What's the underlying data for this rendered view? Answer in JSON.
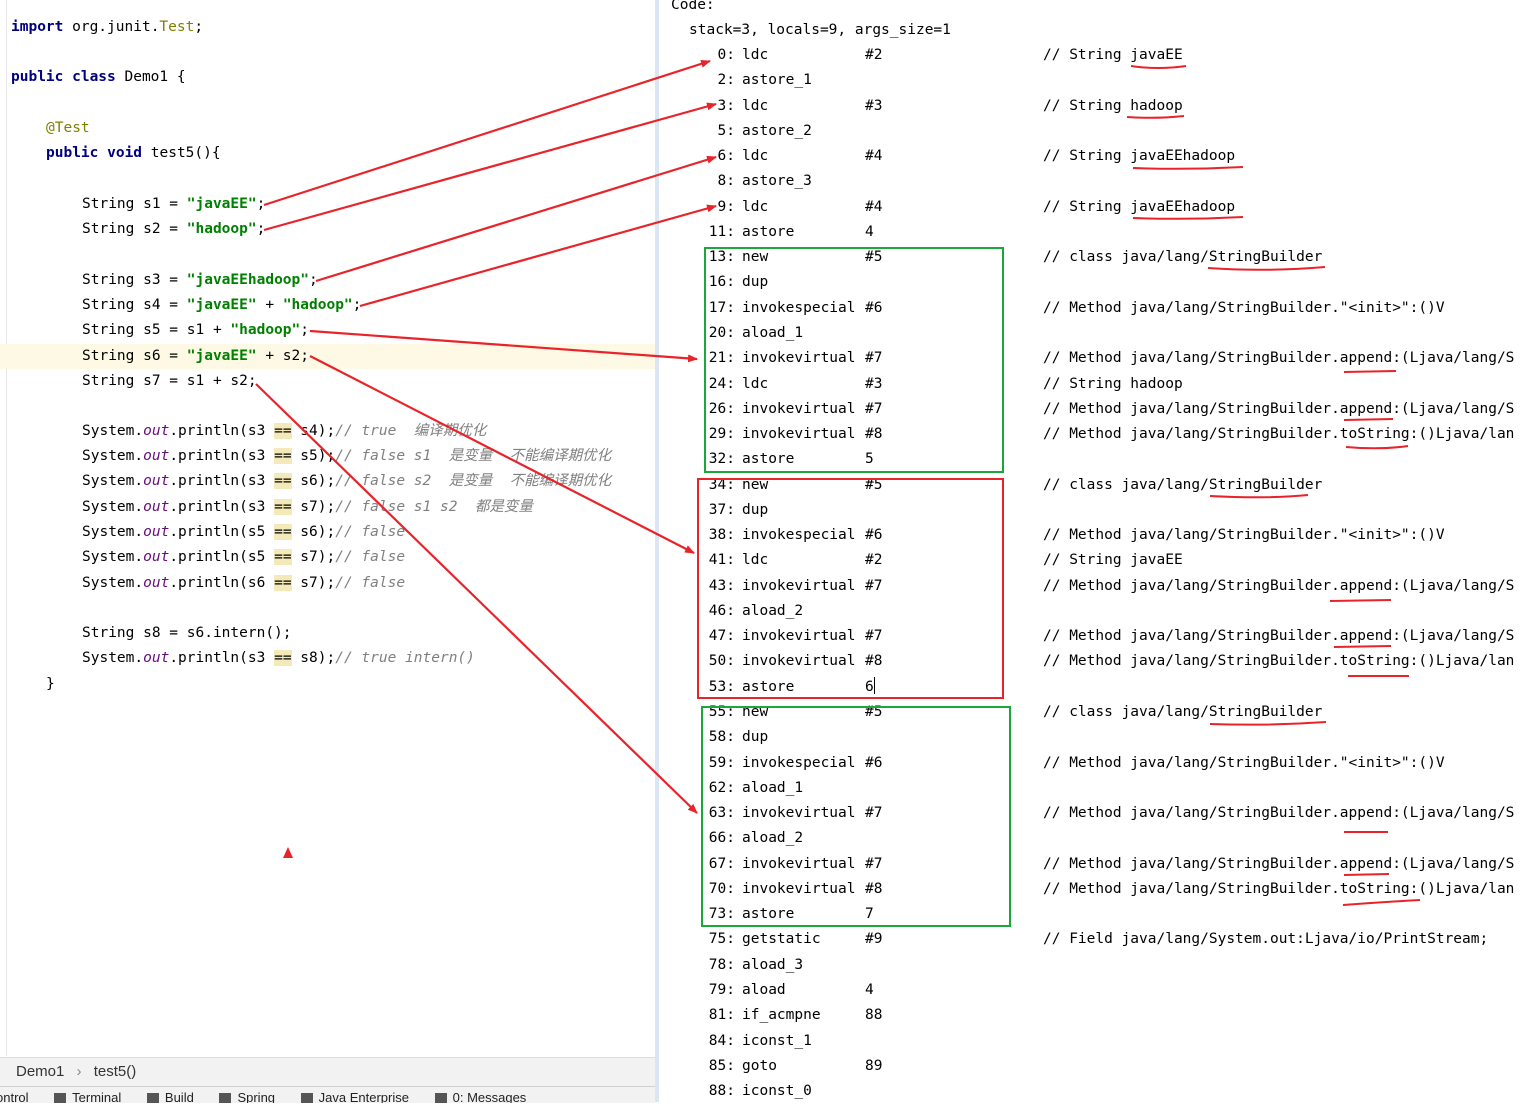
{
  "source": {
    "l1": {
      "kw": "import",
      "rest": " org.junit.",
      "cls": "Test",
      "end": ";"
    },
    "l2": {
      "kw": "public class",
      "rest": " Demo1 {"
    },
    "l3": {
      "ann": "@Test"
    },
    "l4": {
      "kw": "public void",
      "rest": " test5(){"
    },
    "s1": {
      "pre": "String s1 = ",
      "str": "\"javaEE\"",
      "end": ";"
    },
    "s2": {
      "pre": "String s2 = ",
      "str": "\"hadoop\"",
      "end": ";"
    },
    "s3": {
      "pre": "String s3 = ",
      "str": "\"javaEEhadoop\"",
      "end": ";"
    },
    "s4": {
      "pre": "String s4 = ",
      "str1": "\"javaEE\"",
      "mid": " + ",
      "str2": "\"hadoop\"",
      "end": ";"
    },
    "s5": {
      "pre": "String s5 = s1 + ",
      "str": "\"hadoop\"",
      "end": ";"
    },
    "s6": {
      "pre": "String s6 = ",
      "str": "\"javaEE\"",
      "end": " + s2;"
    },
    "s7": {
      "text": "String s7 = s1 + s2;"
    },
    "printlns": [
      {
        "arg": "s3",
        "rhs": " s4);",
        "cmt": "// true  编译期优化"
      },
      {
        "arg": "s3",
        "rhs": " s5);",
        "cmt": "// false s1  是变量  不能编译期优化"
      },
      {
        "arg": "s3",
        "rhs": " s6);",
        "cmt": "// false s2  是变量  不能编译期优化"
      },
      {
        "arg": "s3",
        "rhs": " s7);",
        "cmt": "// false s1 s2  都是变量"
      },
      {
        "arg": "s5",
        "rhs": " s6);",
        "cmt": "// false"
      },
      {
        "arg": "s5",
        "rhs": " s7);",
        "cmt": "// false"
      },
      {
        "arg": "s6",
        "rhs": " s7);",
        "cmt": "// false"
      }
    ],
    "sys": "System.",
    "out": "out",
    "println": ".println(",
    "eq": "==",
    "s8": {
      "text": "String s8 = s6.intern();"
    },
    "last_println": {
      "arg": "s3",
      "rhs": " s8);",
      "cmt": "// true intern()"
    },
    "close": "}"
  },
  "breadcrumb": {
    "class": "Demo1",
    "sep": "›",
    "method": "test5()"
  },
  "toolwindows": [
    "ontrol",
    "Terminal",
    "Build",
    "Spring",
    "Java Enterprise",
    "0: Messages"
  ],
  "bytecode": {
    "header": "Code:",
    "stack": "stack=3, locals=9, args_size=1",
    "lines": [
      {
        "off": "0:",
        "op": "ldc",
        "arg": "#2",
        "cmt": "// String javaEE"
      },
      {
        "off": "2:",
        "op": "astore_1",
        "arg": "",
        "cmt": ""
      },
      {
        "off": "3:",
        "op": "ldc",
        "arg": "#3",
        "cmt": "// String hadoop"
      },
      {
        "off": "5:",
        "op": "astore_2",
        "arg": "",
        "cmt": ""
      },
      {
        "off": "6:",
        "op": "ldc",
        "arg": "#4",
        "cmt": "// String javaEEhadoop"
      },
      {
        "off": "8:",
        "op": "astore_3",
        "arg": "",
        "cmt": ""
      },
      {
        "off": "9:",
        "op": "ldc",
        "arg": "#4",
        "cmt": "// String javaEEhadoop"
      },
      {
        "off": "11:",
        "op": "astore",
        "arg": "4",
        "cmt": ""
      },
      {
        "off": "13:",
        "op": "new",
        "arg": "#5",
        "cmt": "// class java/lang/StringBuilder"
      },
      {
        "off": "16:",
        "op": "dup",
        "arg": "",
        "cmt": ""
      },
      {
        "off": "17:",
        "op": "invokespecial",
        "arg": "#6",
        "cmt": "// Method java/lang/StringBuilder.\"<init>\":()V"
      },
      {
        "off": "20:",
        "op": "aload_1",
        "arg": "",
        "cmt": ""
      },
      {
        "off": "21:",
        "op": "invokevirtual",
        "arg": "#7",
        "cmt": "// Method java/lang/StringBuilder.append:(Ljava/lang/S"
      },
      {
        "off": "24:",
        "op": "ldc",
        "arg": "#3",
        "cmt": "// String hadoop"
      },
      {
        "off": "26:",
        "op": "invokevirtual",
        "arg": "#7",
        "cmt": "// Method java/lang/StringBuilder.append:(Ljava/lang/S"
      },
      {
        "off": "29:",
        "op": "invokevirtual",
        "arg": "#8",
        "cmt": "// Method java/lang/StringBuilder.toString:()Ljava/lan"
      },
      {
        "off": "32:",
        "op": "astore",
        "arg": "5",
        "cmt": ""
      },
      {
        "off": "34:",
        "op": "new",
        "arg": "#5",
        "cmt": "// class java/lang/StringBuilder"
      },
      {
        "off": "37:",
        "op": "dup",
        "arg": "",
        "cmt": ""
      },
      {
        "off": "38:",
        "op": "invokespecial",
        "arg": "#6",
        "cmt": "// Method java/lang/StringBuilder.\"<init>\":()V"
      },
      {
        "off": "41:",
        "op": "ldc",
        "arg": "#2",
        "cmt": "// String javaEE"
      },
      {
        "off": "43:",
        "op": "invokevirtual",
        "arg": "#7",
        "cmt": "// Method java/lang/StringBuilder.append:(Ljava/lang/S"
      },
      {
        "off": "46:",
        "op": "aload_2",
        "arg": "",
        "cmt": ""
      },
      {
        "off": "47:",
        "op": "invokevirtual",
        "arg": "#7",
        "cmt": "// Method java/lang/StringBuilder.append:(Ljava/lang/S"
      },
      {
        "off": "50:",
        "op": "invokevirtual",
        "arg": "#8",
        "cmt": "// Method java/lang/StringBuilder.toString:()Ljava/lan"
      },
      {
        "off": "53:",
        "op": "astore",
        "arg": "6",
        "cmt": ""
      },
      {
        "off": "55:",
        "op": "new",
        "arg": "#5",
        "cmt": "// class java/lang/StringBuilder"
      },
      {
        "off": "58:",
        "op": "dup",
        "arg": "",
        "cmt": ""
      },
      {
        "off": "59:",
        "op": "invokespecial",
        "arg": "#6",
        "cmt": "// Method java/lang/StringBuilder.\"<init>\":()V"
      },
      {
        "off": "62:",
        "op": "aload_1",
        "arg": "",
        "cmt": ""
      },
      {
        "off": "63:",
        "op": "invokevirtual",
        "arg": "#7",
        "cmt": "// Method java/lang/StringBuilder.append:(Ljava/lang/S"
      },
      {
        "off": "66:",
        "op": "aload_2",
        "arg": "",
        "cmt": ""
      },
      {
        "off": "67:",
        "op": "invokevirtual",
        "arg": "#7",
        "cmt": "// Method java/lang/StringBuilder.append:(Ljava/lang/S"
      },
      {
        "off": "70:",
        "op": "invokevirtual",
        "arg": "#8",
        "cmt": "// Method java/lang/StringBuilder.toString:()Ljava/lan"
      },
      {
        "off": "73:",
        "op": "astore",
        "arg": "7",
        "cmt": ""
      },
      {
        "off": "75:",
        "op": "getstatic",
        "arg": "#9",
        "cmt": "// Field java/lang/System.out:Ljava/io/PrintStream;"
      },
      {
        "off": "78:",
        "op": "aload_3",
        "arg": "",
        "cmt": ""
      },
      {
        "off": "79:",
        "op": "aload",
        "arg": "4",
        "cmt": ""
      },
      {
        "off": "81:",
        "op": "if_acmpne",
        "arg": "88",
        "cmt": ""
      },
      {
        "off": "84:",
        "op": "iconst_1",
        "arg": "",
        "cmt": ""
      },
      {
        "off": "85:",
        "op": "goto",
        "arg": "89",
        "cmt": ""
      },
      {
        "off": "88:",
        "op": "iconst_0",
        "arg": "",
        "cmt": ""
      }
    ]
  },
  "colors": {
    "arrow": "#e8232a",
    "green_box": "#1aa83a",
    "red_box": "#e8232a",
    "editor_bg": "#ffffff",
    "line_highlight": "#fdf9e4"
  }
}
